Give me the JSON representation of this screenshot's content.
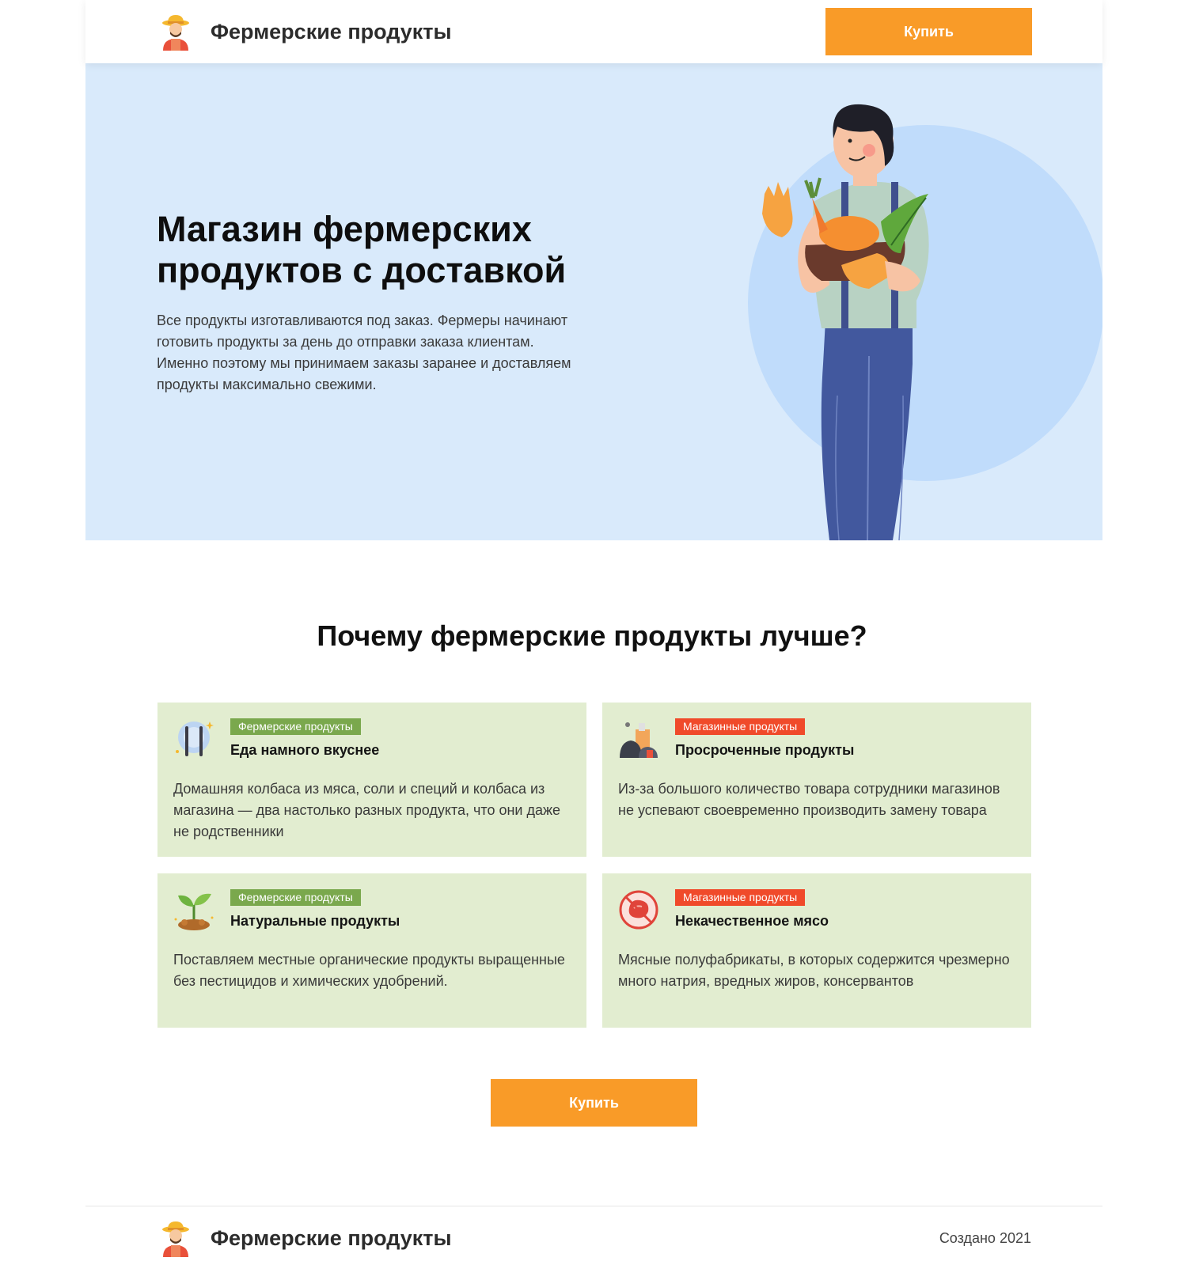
{
  "header": {
    "brand": "Фермерские продукты",
    "buy_label": "Купить"
  },
  "hero": {
    "title": "Магазин фермерских продуктов с доставкой",
    "text": "Все продукты изготавливаются под заказ. Фермеры начинают готовить продукты за день до отправки заказа клиентам. Именно поэтому мы принимаем заказы заранее и доставляем продукты максимально свежими."
  },
  "section": {
    "title": "Почему фермерские продукты лучше?",
    "cards": [
      {
        "tag": "Фермерские продукты",
        "tag_color": "#7aa84d",
        "icon": "plate-cutlery-icon",
        "title": "Еда намного вкуснее",
        "text": "Домашняя колбаса из мяса, соли и специй и колбаса из магазина — два настолько разных продукта, что они даже не родственники"
      },
      {
        "tag": "Магазинные продукты",
        "tag_color": "#f04a2a",
        "icon": "trash-bags-icon",
        "title": "Просроченные продукты",
        "text": "Из-за большого количество товара сотрудники магазинов не успевают своевременно производить замену товара"
      },
      {
        "tag": "Фермерские продукты",
        "tag_color": "#7aa84d",
        "icon": "sprout-icon",
        "title": "Натуральные продукты",
        "text": "Поставляем местные органические продукты выращенные без пестицидов и химических удобрений."
      },
      {
        "tag": "Магазинные продукты",
        "tag_color": "#f04a2a",
        "icon": "no-meat-icon",
        "title": "Некачественное мясо",
        "text": "Мясные полуфабрикаты, в которых содержится чрезмерно много натрия, вредных жиров, консервантов"
      }
    ],
    "buy_label": "Купить"
  },
  "footer": {
    "brand": "Фермерские продукты",
    "note": "Создано 2021"
  },
  "colors": {
    "accent": "#f99b28",
    "hero_bg": "#d9eafb",
    "card_bg": "#e2edd0",
    "tag_farm": "#7aa84d",
    "tag_store": "#f04a2a"
  }
}
